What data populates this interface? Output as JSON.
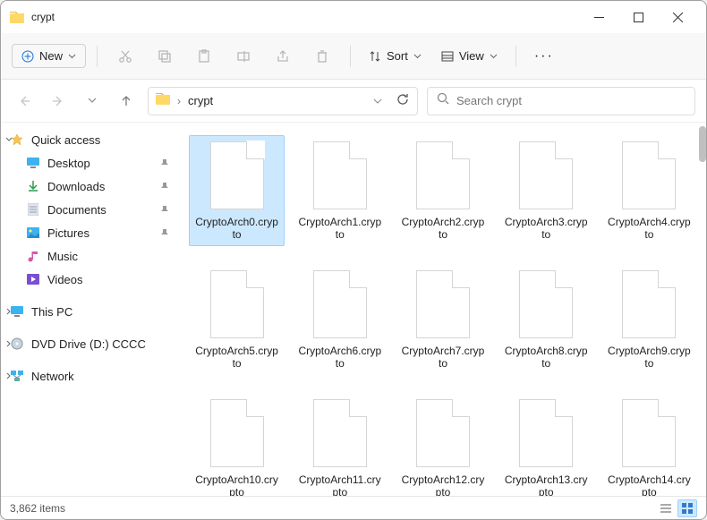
{
  "window": {
    "title": "crypt"
  },
  "toolbar": {
    "new_label": "New",
    "sort_label": "Sort",
    "view_label": "View"
  },
  "address": {
    "crumb": "crypt"
  },
  "search": {
    "placeholder": "Search crypt"
  },
  "sidebar": {
    "quick_access": "Quick access",
    "items": [
      {
        "label": "Desktop",
        "icon": "desktop"
      },
      {
        "label": "Downloads",
        "icon": "downloads"
      },
      {
        "label": "Documents",
        "icon": "documents"
      },
      {
        "label": "Pictures",
        "icon": "pictures"
      },
      {
        "label": "Music",
        "icon": "music"
      },
      {
        "label": "Videos",
        "icon": "videos"
      }
    ],
    "this_pc": "This PC",
    "dvd": "DVD Drive (D:) CCCC",
    "network": "Network"
  },
  "files": [
    {
      "name": "CryptoArch0.crypto",
      "selected": true
    },
    {
      "name": "CryptoArch1.crypto"
    },
    {
      "name": "CryptoArch2.crypto"
    },
    {
      "name": "CryptoArch3.crypto"
    },
    {
      "name": "CryptoArch4.crypto"
    },
    {
      "name": "CryptoArch5.crypto"
    },
    {
      "name": "CryptoArch6.crypto"
    },
    {
      "name": "CryptoArch7.crypto"
    },
    {
      "name": "CryptoArch8.crypto"
    },
    {
      "name": "CryptoArch9.crypto"
    },
    {
      "name": "CryptoArch10.crypto"
    },
    {
      "name": "CryptoArch11.crypto"
    },
    {
      "name": "CryptoArch12.crypto"
    },
    {
      "name": "CryptoArch13.crypto"
    },
    {
      "name": "CryptoArch14.crypto"
    }
  ],
  "status": {
    "count": "3,862 items"
  }
}
